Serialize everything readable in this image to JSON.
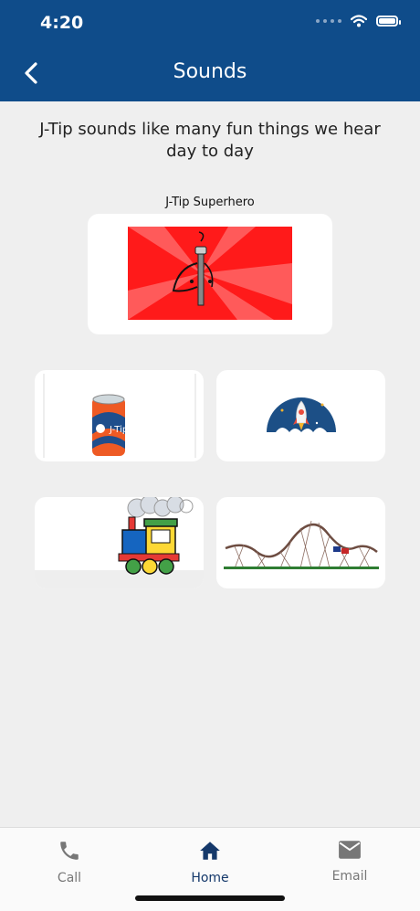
{
  "status_bar": {
    "time": "4:20"
  },
  "header": {
    "title": "Sounds"
  },
  "intro": "J-Tip sounds like many fun things we hear day to day",
  "hero": {
    "label": "J-Tip Superhero"
  },
  "soda": {
    "brand": "J-Tip"
  },
  "tabs": [
    {
      "label": "Call",
      "icon": "phone-icon"
    },
    {
      "label": "Home",
      "icon": "home-icon"
    },
    {
      "label": "Email",
      "icon": "mail-icon"
    }
  ],
  "colors": {
    "header": "#0f4c8a",
    "active_tab": "#14386a",
    "hero_red": "#ff1a1a",
    "rocket_bg": "#1c4f86"
  }
}
